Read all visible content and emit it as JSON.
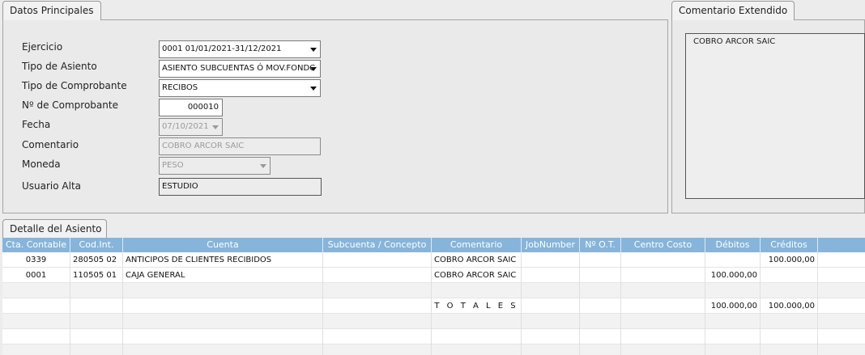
{
  "datos": {
    "tab": "Datos Principales",
    "ejercicio": {
      "label": "Ejercicio",
      "value": "0001 01/01/2021-31/12/2021"
    },
    "tipo_asiento": {
      "label": "Tipo de Asiento",
      "value": "ASIENTO SUBCUENTAS Ó MOV.FONDC"
    },
    "tipo_comprobante": {
      "label": "Tipo de Comprobante",
      "value": "RECIBOS"
    },
    "nro_comprobante": {
      "label": "Nº de Comprobante",
      "value": "000010"
    },
    "fecha": {
      "label": "Fecha",
      "value": "07/10/2021"
    },
    "comentario": {
      "label": "Comentario",
      "value": "COBRO ARCOR SAIC"
    },
    "moneda": {
      "label": "Moneda",
      "value": "PESO"
    },
    "usuario": {
      "label": "Usuario Alta",
      "value": "ESTUDIO"
    }
  },
  "extendido": {
    "tab": "Comentario Extendido",
    "text": "COBRO ARCOR SAIC"
  },
  "detalle": {
    "tab": "Detalle del Asiento",
    "columns": [
      "Cta. Contable",
      "Cod.Int.",
      "Cuenta",
      "Subcuenta / Concepto",
      "Comentario",
      "JobNumber",
      "Nº O.T.",
      "Centro Costo",
      "Débitos",
      "Créditos"
    ],
    "rows": [
      [
        "0339",
        "280505 02",
        "ANTICIPOS DE CLIENTES RECIBIDOS",
        "",
        "COBRO ARCOR SAIC",
        "",
        "",
        "",
        "",
        "100.000,00"
      ],
      [
        "0001",
        "110505 01",
        "CAJA GENERAL",
        "",
        "COBRO ARCOR SAIC",
        "",
        "",
        "",
        "100.000,00",
        ""
      ]
    ],
    "totales": {
      "label": "T O T A L E S",
      "debitos": "100.000,00",
      "creditos": "100.000,00"
    }
  }
}
